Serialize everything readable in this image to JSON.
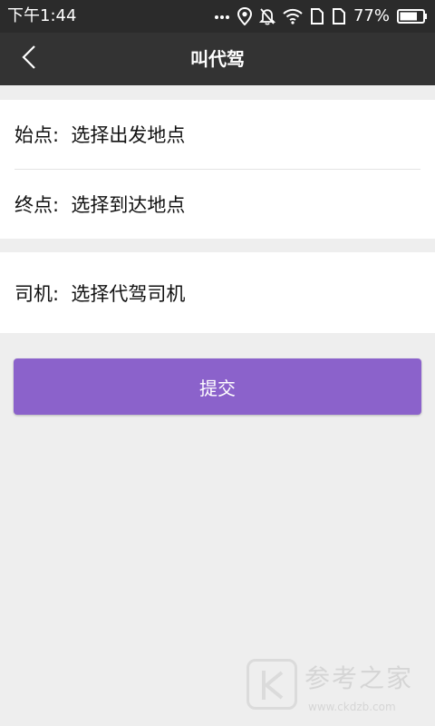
{
  "status_bar": {
    "time": "下午1:44",
    "battery_percent": "77%",
    "battery_level": 0.77,
    "icons": [
      "more-dots-icon",
      "location-pin-icon",
      "bell-muted-icon",
      "wifi-icon",
      "sim-card-icon",
      "sim-card-icon",
      "battery-icon"
    ]
  },
  "nav": {
    "title": "叫代驾",
    "back_icon": "chevron-left-icon"
  },
  "route": {
    "start_label": "始点:  选择出发地点",
    "end_label": "终点:  选择到达地点"
  },
  "driver": {
    "label": "司机:  选择代驾司机"
  },
  "submit": {
    "label": "提交"
  },
  "watermark": {
    "title": "参考之家",
    "url": "www.ckdzb.com"
  },
  "colors": {
    "status_bar": "#2b2b2b",
    "nav_bar": "#333333",
    "accent": "#8b62cb",
    "page_background": "#eeeeee"
  }
}
